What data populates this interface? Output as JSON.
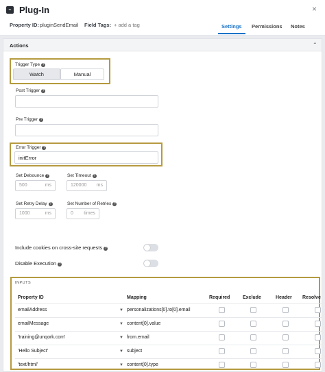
{
  "header": {
    "title": "Plug-In",
    "close_glyph": "×",
    "property_id_label": "Property ID:",
    "property_id_value": "pluginSendEmail",
    "field_tags_label": "Field Tags:",
    "add_tag": "+ add a tag",
    "tabs": [
      {
        "label": "Settings",
        "active": true
      },
      {
        "label": "Permissions",
        "active": false
      },
      {
        "label": "Notes",
        "active": false
      }
    ]
  },
  "actions": {
    "section_title": "Actions",
    "trigger_type": {
      "label": "Trigger Type",
      "options": [
        "Watch",
        "Manual"
      ],
      "selected": "Watch"
    },
    "post_trigger": {
      "label": "Post Trigger",
      "value": ""
    },
    "pre_trigger": {
      "label": "Pre Trigger",
      "value": ""
    },
    "error_trigger": {
      "label": "Error Trigger",
      "value": "initError"
    },
    "set_debounce": {
      "label": "Set Debounce",
      "value": "500",
      "unit": "ms"
    },
    "set_timeout": {
      "label": "Set Timeout",
      "value": "120000",
      "unit": "ms"
    },
    "set_retry_delay": {
      "label": "Set Retry Delay",
      "value": "1000",
      "unit": "ms"
    },
    "set_number_of_retries": {
      "label": "Set Number of Retries",
      "value": "0",
      "unit": "times"
    },
    "include_cookies": {
      "label": "Include cookies on cross-site requests",
      "on": false
    },
    "disable_execution": {
      "label": "Disable Execution",
      "on": false
    }
  },
  "inputs": {
    "title": "INPUTS",
    "columns": [
      "Property ID",
      "Mapping",
      "Required",
      "Exclude",
      "Header",
      "Resolve"
    ],
    "rows": [
      {
        "property_id": "emailAddress",
        "mapping": "personalizations[0].to[0].email"
      },
      {
        "property_id": "emailMessage",
        "mapping": "content[0].value"
      },
      {
        "property_id": "'training@unqork.com'",
        "mapping": "from.email"
      },
      {
        "property_id": "'Hello Subject'",
        "mapping": "subject"
      },
      {
        "property_id": "'text/html'",
        "mapping": "content[0].type"
      }
    ]
  },
  "icons": {
    "help": "question-icon",
    "dropdown": "chevron-down-icon",
    "plugin": "plug-icon"
  },
  "colors": {
    "accent": "#1a73c8",
    "highlight": "#b59a3e"
  }
}
